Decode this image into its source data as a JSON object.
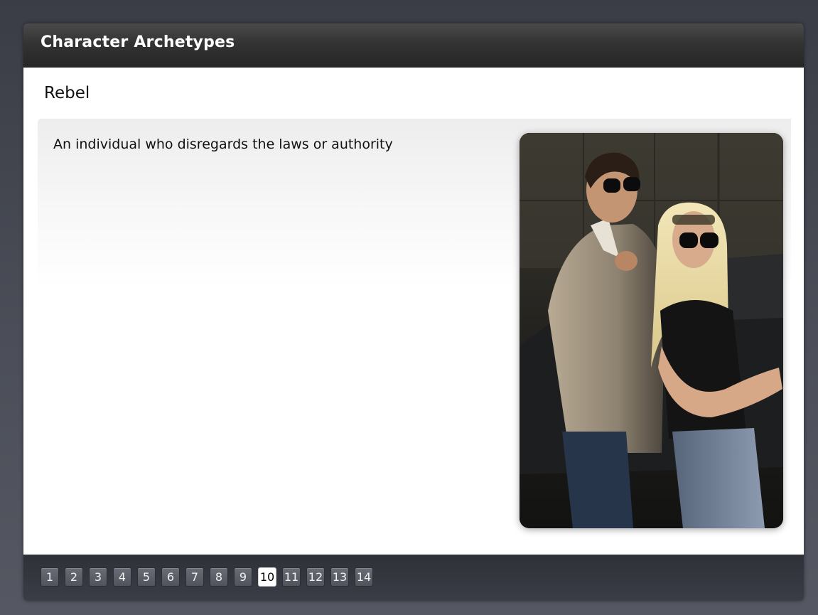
{
  "header": {
    "title": "Character Archetypes"
  },
  "slide": {
    "title": "Rebel",
    "description": "An individual who disregards the laws or authority",
    "image_alt": "photo-of-two-people-in-sunglasses"
  },
  "pagination": {
    "current": 10,
    "pages": [
      "1",
      "2",
      "3",
      "4",
      "5",
      "6",
      "7",
      "8",
      "9",
      "10",
      "11",
      "12",
      "13",
      "14"
    ]
  }
}
